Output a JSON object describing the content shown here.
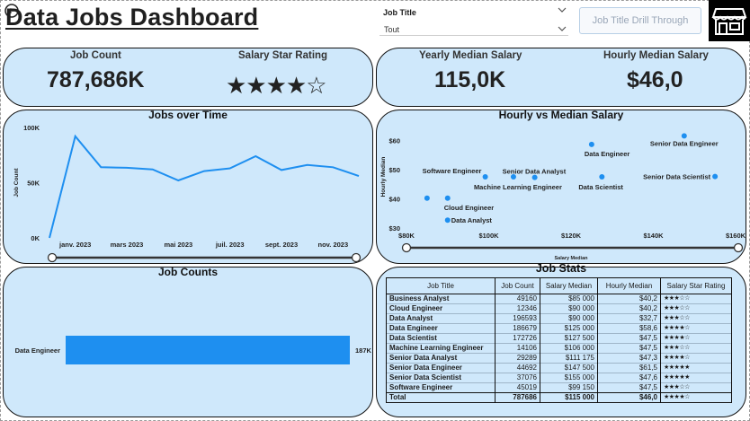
{
  "header": {
    "title": "Data Jobs Dashboard",
    "slicer_label": "Job Title",
    "slicer_value": "Tout",
    "drill_button": "Job Title Drill Through"
  },
  "kpis": {
    "job_count_label": "Job Count",
    "job_count_value": "787,686K",
    "star_label": "Salary Star Rating",
    "star_value": "★★★★☆",
    "yearly_label": "Yearly Median Salary",
    "yearly_value": "115,0K",
    "hourly_label": "Hourly Median Salary",
    "hourly_value": "$46,0"
  },
  "chart_data": [
    {
      "type": "line",
      "title": "Jobs over Time",
      "ylabel": "Job Count",
      "x_ticks": [
        "janv. 2023",
        "mars 2023",
        "mai 2023",
        "juil. 2023",
        "sept. 2023",
        "nov. 2023"
      ],
      "y_ticks": [
        "0K",
        "50K",
        "100K"
      ],
      "x": [
        0,
        1,
        2,
        3,
        4,
        5,
        6,
        7,
        8,
        9,
        10,
        11,
        12
      ],
      "values": [
        0,
        92000,
        64000,
        63500,
        62000,
        52000,
        60500,
        63000,
        74000,
        61500,
        66000,
        64000,
        56000
      ],
      "ylim": [
        0,
        100000
      ]
    },
    {
      "type": "scatter",
      "title": "Hourly vs Median Salary",
      "xlabel": "Salary Median",
      "ylabel": "Hourly Median",
      "x_ticks": [
        "$80K",
        "$100K",
        "$120K",
        "$140K",
        "$160K"
      ],
      "y_ticks": [
        "$30",
        "$40",
        "$50",
        "$60"
      ],
      "xlim": [
        80000,
        160000
      ],
      "ylim": [
        30,
        65
      ],
      "points": [
        {
          "label": "Business Analyst",
          "x": 85000,
          "y": 40.2,
          "show_label": false
        },
        {
          "label": "Cloud Engineer",
          "x": 90000,
          "y": 40.2,
          "show_label": true
        },
        {
          "label": "Data Analyst",
          "x": 90000,
          "y": 32.7,
          "show_label": true
        },
        {
          "label": "Data Engineer",
          "x": 125000,
          "y": 58.6,
          "show_label": true
        },
        {
          "label": "Data Scientist",
          "x": 127500,
          "y": 47.5,
          "show_label": true
        },
        {
          "label": "Machine Learning Engineer",
          "x": 106000,
          "y": 47.5,
          "show_label": true
        },
        {
          "label": "Senior Data Analyst",
          "x": 111175,
          "y": 47.3,
          "show_label": true
        },
        {
          "label": "Senior Data Engineer",
          "x": 147500,
          "y": 61.5,
          "show_label": true
        },
        {
          "label": "Senior Data Scientist",
          "x": 155000,
          "y": 47.6,
          "show_label": true
        },
        {
          "label": "Software Engineer",
          "x": 99150,
          "y": 47.5,
          "show_label": true
        }
      ]
    },
    {
      "type": "bar",
      "orientation": "horizontal",
      "title": "Job Counts",
      "categories": [
        "Data Engineer"
      ],
      "values": [
        186679
      ],
      "value_labels": [
        "187K"
      ],
      "xlim": [
        0,
        186679
      ]
    }
  ],
  "table": {
    "title": "Job Stats",
    "headers": [
      "Job Title",
      "Job Count",
      "Salary Median",
      "Hourly Median",
      "Salary Star Rating"
    ],
    "rows": [
      [
        "Business Analyst",
        "49160",
        "$85 000",
        "$40,2",
        "★★★☆☆"
      ],
      [
        "Cloud Engineer",
        "12346",
        "$90 000",
        "$40,2",
        "★★★☆☆"
      ],
      [
        "Data Analyst",
        "196593",
        "$90 000",
        "$32,7",
        "★★★☆☆"
      ],
      [
        "Data Engineer",
        "186679",
        "$125 000",
        "$58,6",
        "★★★★☆"
      ],
      [
        "Data Scientist",
        "172726",
        "$127 500",
        "$47,5",
        "★★★★☆"
      ],
      [
        "Machine Learning Engineer",
        "14106",
        "$106 000",
        "$47,5",
        "★★★☆☆"
      ],
      [
        "Senior Data Analyst",
        "29289",
        "$111 175",
        "$47,3",
        "★★★★☆"
      ],
      [
        "Senior Data Engineer",
        "44692",
        "$147 500",
        "$61,5",
        "★★★★★"
      ],
      [
        "Senior Data Scientist",
        "37076",
        "$155 000",
        "$47,6",
        "★★★★★"
      ],
      [
        "Software Engineer",
        "45019",
        "$99 150",
        "$47,5",
        "★★★☆☆"
      ]
    ],
    "total": [
      "Total",
      "787686",
      "$115 000",
      "$46,0",
      "★★★★☆"
    ]
  },
  "colors": {
    "card_bg": "#cfe8fb",
    "series": "#1e8ff0",
    "border": "#111111"
  },
  "icons": {
    "back": "back-arrow-icon",
    "store": "store-icon",
    "chevron": "chevron-down-icon"
  }
}
